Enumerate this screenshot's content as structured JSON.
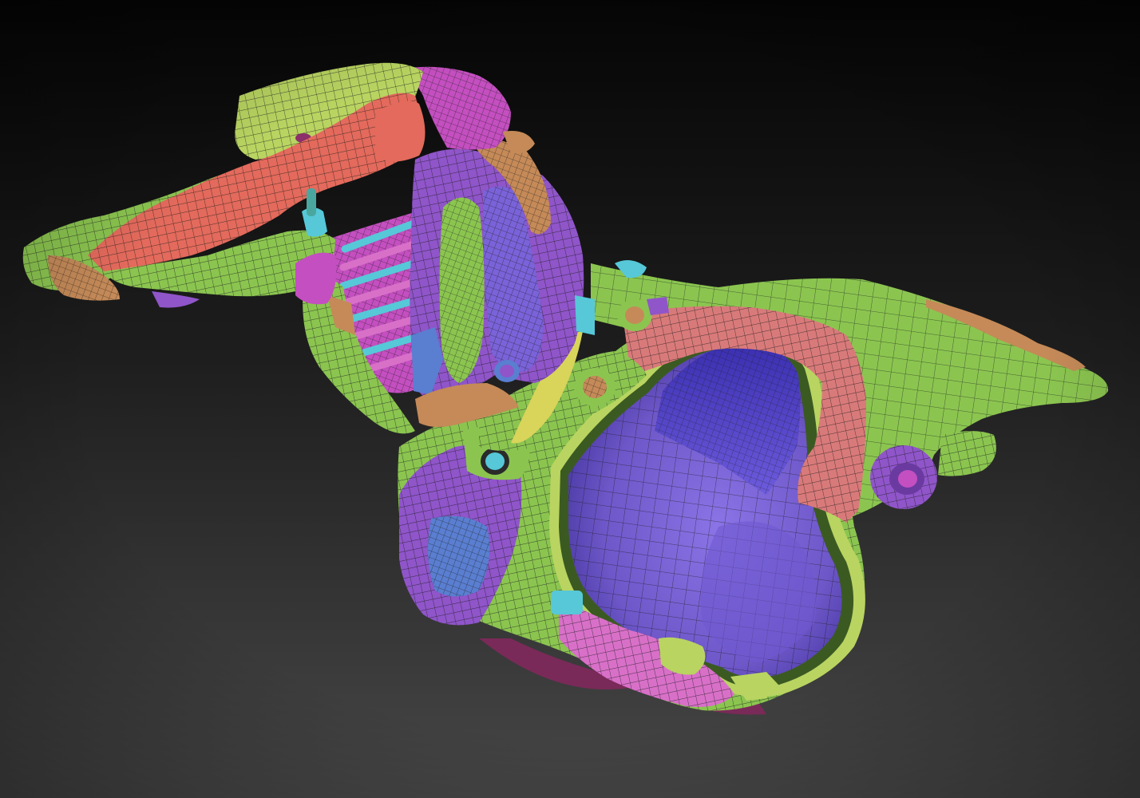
{
  "viewport": {
    "background_top": "#050505",
    "background_bottom": "#474747",
    "wire_color": "#1a1a1a"
  },
  "polygroup_colors": {
    "green": "#8bc550",
    "yellow_green": "#b9d461",
    "red": "#e36a5c",
    "salmon": "#d97a7a",
    "purple": "#8f55c9",
    "violet_inner": "#7a63d9",
    "blue_inner": "#5a4fd0",
    "magenta": "#c44fc0",
    "pink": "#d870c8",
    "cyan": "#56c8d8",
    "teal": "#4aa7a0",
    "orange_tan": "#c58a58",
    "yellow": "#d9d45a",
    "dark_magenta": "#8c2f6a"
  }
}
